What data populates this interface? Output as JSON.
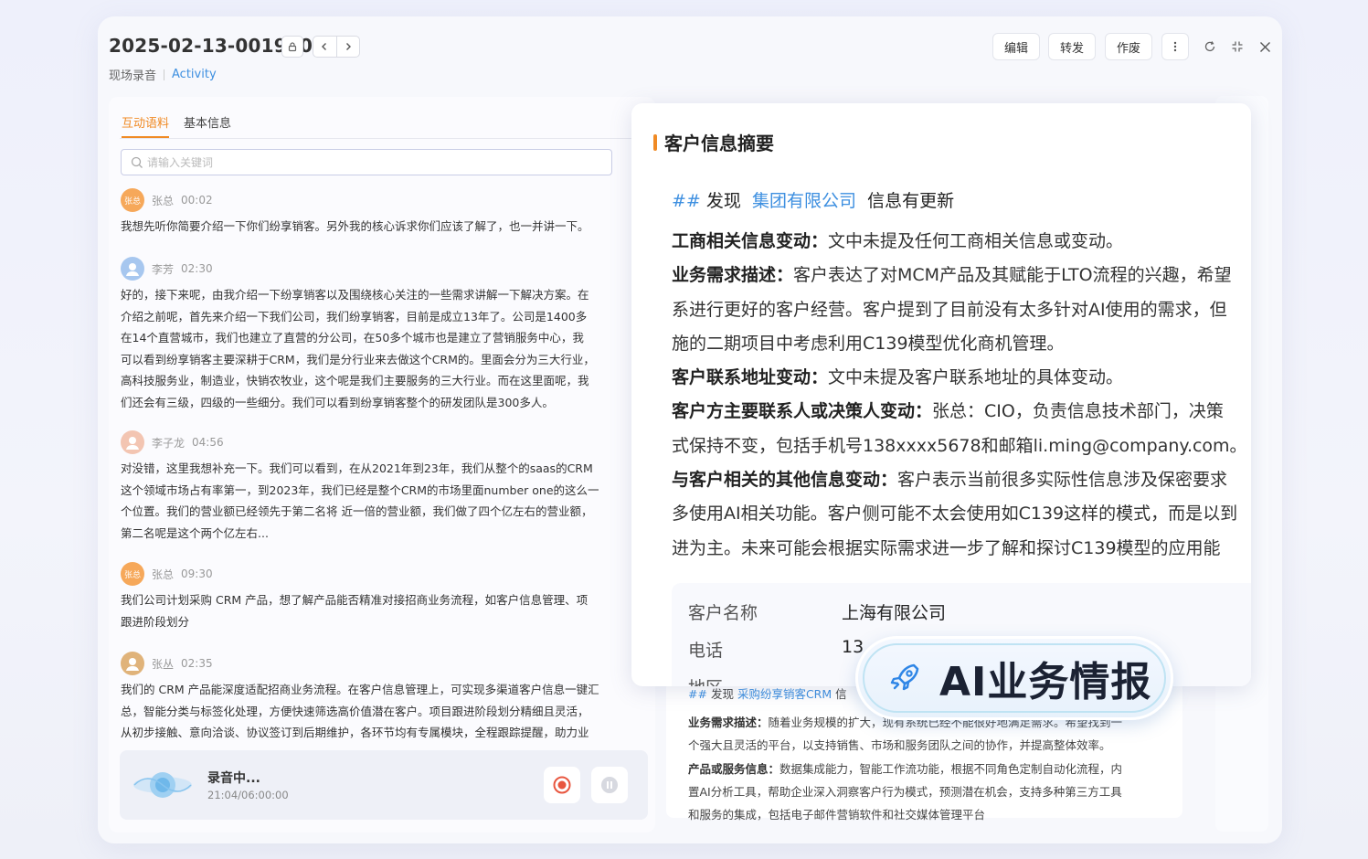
{
  "header": {
    "title": "2025-02-13-001960",
    "subtitle": "现场录音",
    "subtitle_link": "Activity",
    "buttons": [
      "编辑",
      "转发",
      "作废"
    ]
  },
  "left": {
    "tabs": [
      "互动语料",
      "基本信息"
    ],
    "search_placeholder": "请输入关键词",
    "messages": [
      {
        "speaker": "张总",
        "avatar": "张总",
        "time": "00:02",
        "text": "我想先听你简要介绍一下你们纷享销客。另外我的核心诉求你们应该了解了，也一并讲一下。"
      },
      {
        "speaker": "李芳",
        "avatar": "",
        "time": "02:30",
        "text": "好的，接下来呢，由我介绍一下纷享销客以及围绕核心关注的一些需求讲解一下解决方案。在\n介绍之前呢，首先来介绍一下我们公司，我们纷享销客，目前是成立13年了。公司是1400多\n在14个直营城市，我们也建立了直营的分公司，在50多个城市也是建立了营销服务中心，我\n可以看到纷享销客主要深耕于CRM，我们是分行业来去做这个CRM的。里面会分为三大行业，\n高科技服务业，制造业，快销农牧业，这个呢是我们主要服务的三大行业。而在这里面呢，我\n们还会有三级，四级的一些细分。我们可以看到纷享销客整个的研发团队是300多人。"
      },
      {
        "speaker": "李子龙",
        "avatar": "",
        "time": "04:56",
        "text": "对没错，这里我想补充一下。我们可以看到，在从2021年到23年，我们从整个的saas的CRM\n这个领域市场占有率第一，到2023年，我们已经是整个CRM的市场里面number one的这么一\n个位置。我们的营业额已经领先于第二名将 近一倍的营业额，我们做了四个亿左右的营业额，\n第二名呢是这个两个亿左右..."
      },
      {
        "speaker": "张总",
        "avatar": "张总",
        "time": "09:30",
        "text": "我们公司计划采购 CRM 产品，想了解产品能否精准对接招商业务流程，如客户信息管理、项\n跟进阶段划分"
      },
      {
        "speaker": "张丛",
        "avatar": "",
        "time": "02:35",
        "text": "我们的 CRM 产品能深度适配招商业务流程。在客户信息管理上，可实现多渠道客户信息一键汇\n总，智能分类与标签化处理，方便快速筛选高价值潜在客户。项目跟进阶段划分精细且灵活，\n从初步接触、意向洽谈、协议签订到后期维护，各环节均有专属模块，全程跟踪提醒，助力业"
      }
    ],
    "recorder": {
      "title": "录音中...",
      "time": "21:04/06:00:00"
    }
  },
  "card": {
    "title": "客户信息摘要",
    "h2_hash": "##",
    "h2_pre": "发现",
    "h2_company": "集团有限公司",
    "h2_post": "信息有更新",
    "lines": [
      {
        "b": "工商相关信息变动：",
        "t": "文中未提及任何工商相关信息或变动。"
      },
      {
        "b": "业务需求描述：",
        "t": "客户表达了对MCM产品及其赋能于LTO流程的兴趣，希望"
      },
      {
        "b": "",
        "t": "系进行更好的客户经营。客户提到了目前没有太多针对AI使用的需求，但"
      },
      {
        "b": "",
        "t": "施的二期项目中考虑利用C139模型优化商机管理。"
      },
      {
        "b": "客户联系地址变动：",
        "t": "文中未提及客户联系地址的具体变动。"
      },
      {
        "b": "客户方主要联系人或决策人变动：",
        "t": "张总：CIO，负责信息技术部门，决策"
      },
      {
        "b": "",
        "t": "式保持不变，包括手机号138xxxx5678和邮箱li.ming@company.com。"
      },
      {
        "b": "与客户相关的其他信息变动：",
        "t": "客户表示当前很多实际性信息涉及保密要求"
      },
      {
        "b": "",
        "t": "多使用AI相关功能。客户侧可能不太会使用如C139这样的模式，而是以到"
      },
      {
        "b": "",
        "t": "进为主。未来可能会根据实际需求进一步了解和探讨C139模型的应用能"
      }
    ],
    "info": [
      {
        "k": "客户名称",
        "v": "上海有限公司"
      },
      {
        "k": "电话",
        "v": "13"
      },
      {
        "k": "地区",
        "v": ""
      }
    ]
  },
  "bg_panel": {
    "h_hash": "##",
    "h_pre": "发现",
    "h_company": "采购纷享销客CRM",
    "h_post": "信",
    "lines": [
      {
        "b": "业务需求描述：",
        "t": "随着业务规模的扩大，现有系统已经不能很好地满足需求。希望找到一"
      },
      {
        "b": "",
        "t": "个强大且灵活的平台，以支持销售、市场和服务团队之间的协作，并提高整体效率。"
      },
      {
        "b": "产品或服务信息：",
        "t": "数据集成能力，智能工作流功能，根据不同角色定制自动化流程，内"
      },
      {
        "b": "",
        "t": "置AI分析工具，帮助企业深入洞察客户行为模式，预测潜在机会，支持多种第三方工具"
      },
      {
        "b": "",
        "t": "和服务的集成，包括电子邮件营销软件和社交媒体管理平台"
      }
    ]
  },
  "badge": {
    "text": "AI业务情报"
  },
  "colors": {
    "accent": "#f08a24",
    "link": "#3d8fe0"
  }
}
